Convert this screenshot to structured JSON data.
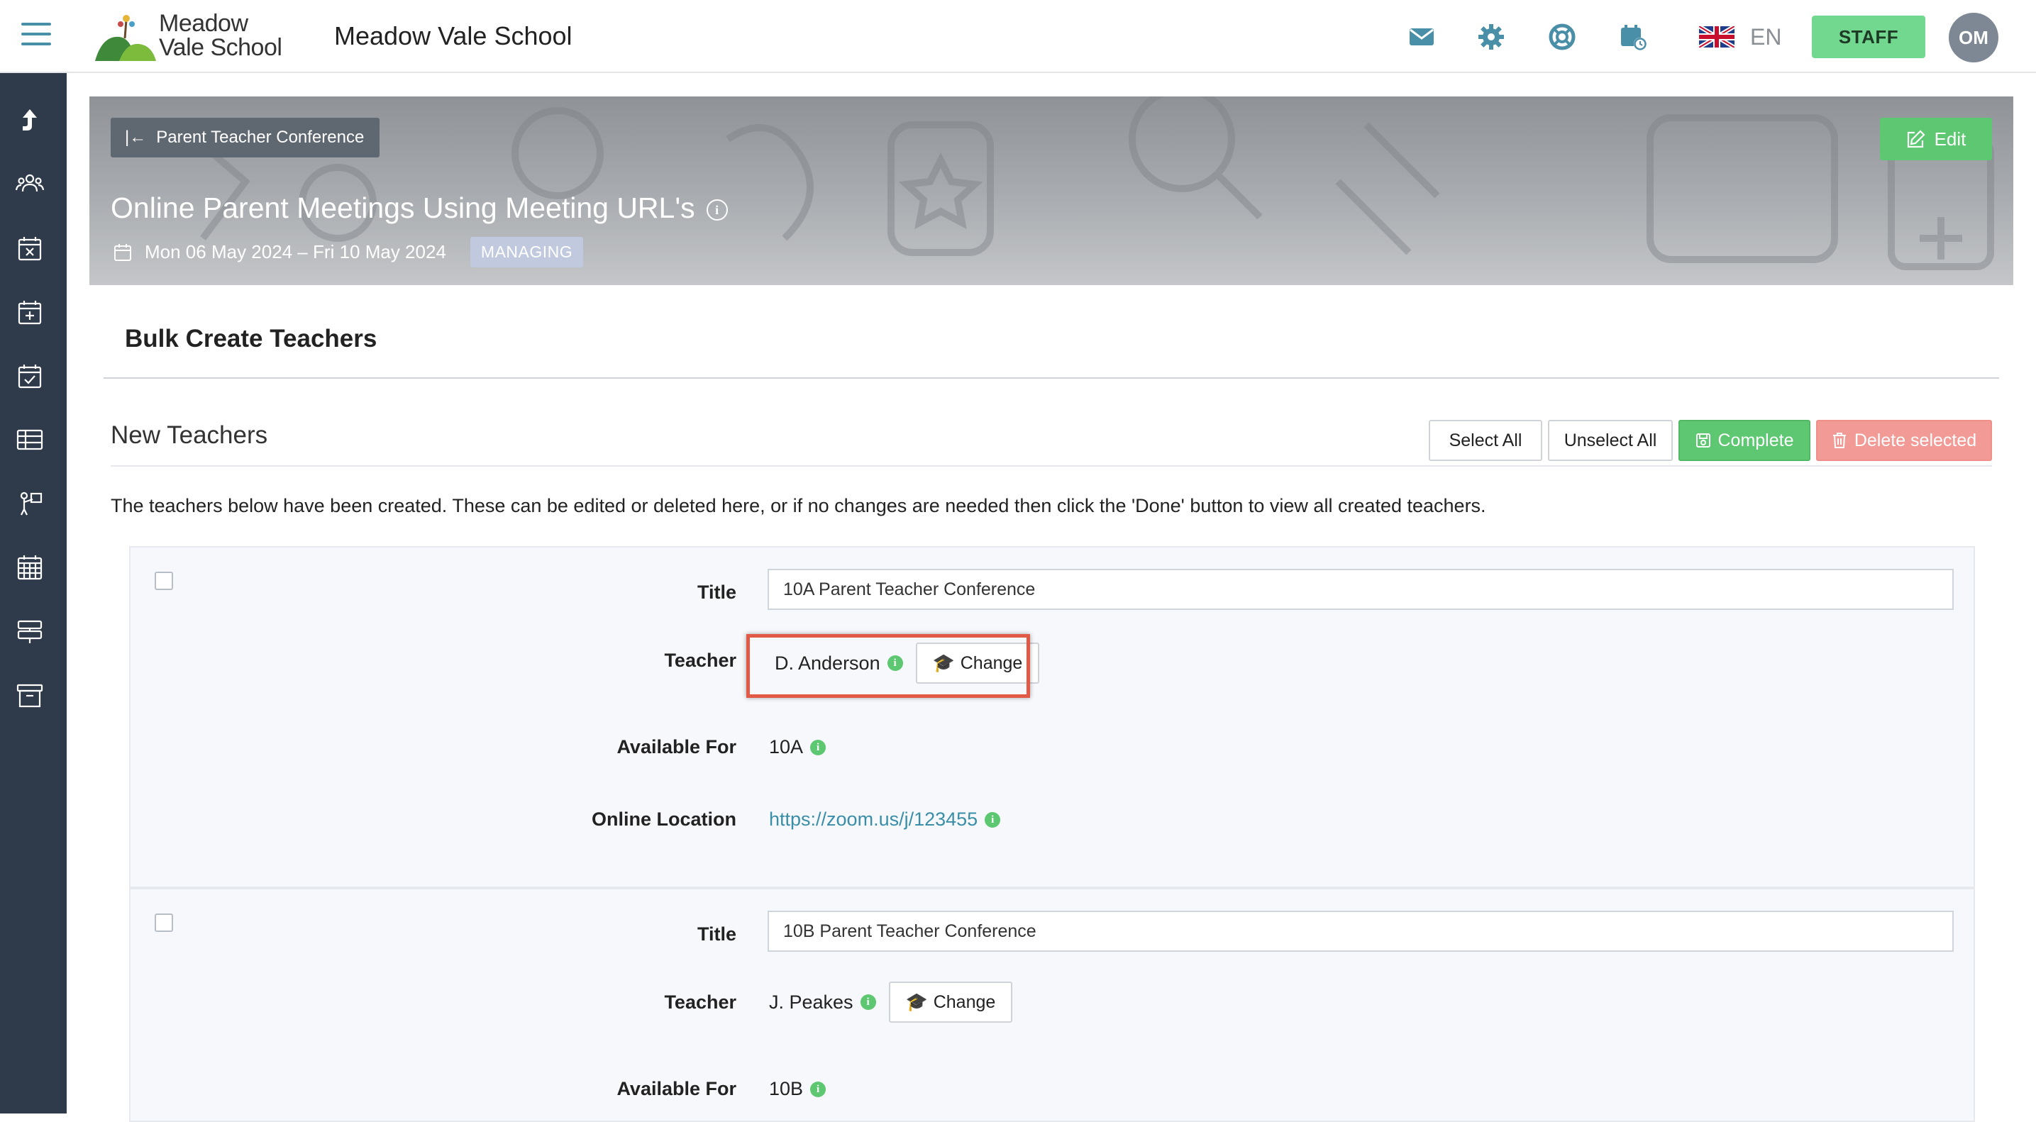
{
  "header": {
    "logo_line1": "Meadow",
    "logo_line2": "Vale School",
    "app_title": "Meadow Vale School",
    "language": "EN",
    "staff_label": "STAFF",
    "avatar_initials": "OM",
    "icons": [
      "envelope-icon",
      "gear-icon",
      "lifebuoy-icon",
      "calendar-clock-icon",
      "uk-flag-icon"
    ]
  },
  "sidebar": {
    "icons": [
      "up-arrow-icon",
      "people-icon",
      "calendar-x-icon",
      "calendar-plus-icon",
      "calendar-check-icon",
      "table-icon",
      "person-board-icon",
      "calendar-grid-icon",
      "signpost-icon",
      "archive-icon"
    ]
  },
  "banner": {
    "back_label": "Parent Teacher Conference",
    "edit_label": "Edit",
    "title": "Online Parent Meetings Using Meeting URL's",
    "date_range": "Mon 06 May 2024 – Fri 10 May 2024",
    "badge": "MANAGING"
  },
  "content": {
    "section_title": "Bulk Create Teachers",
    "subheading": "New Teachers",
    "buttons": {
      "select_all": "Select All",
      "unselect_all": "Unselect All",
      "complete": "Complete",
      "delete_selected": "Delete selected"
    },
    "intro": "The teachers below have been created. These can be edited or deleted here, or if no changes are needed then click the 'Done' button to view all created teachers.",
    "labels": {
      "title": "Title",
      "teacher": "Teacher",
      "available_for": "Available For",
      "online_location": "Online Location",
      "change": "Change"
    },
    "teachers": [
      {
        "title": "10A Parent Teacher Conference",
        "teacher": "D. Anderson",
        "available_for": "10A",
        "online_location": "https://zoom.us/j/123455",
        "selected": false
      },
      {
        "title": "10B Parent Teacher Conference",
        "teacher": "J. Peakes",
        "available_for": "10B",
        "selected": false
      }
    ]
  },
  "colors": {
    "sidebar": "#2f3a4b",
    "accent_green": "#5dc771",
    "staff_green": "#72d88f",
    "danger": "#f19a96",
    "link": "#3a8ea8",
    "highlight": "#e05a45"
  }
}
